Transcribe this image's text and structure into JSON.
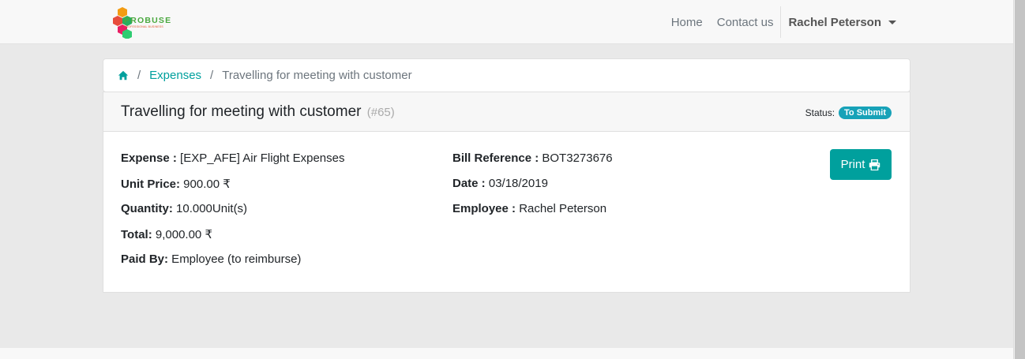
{
  "navbar": {
    "logo_text": "PROBUSE",
    "logo_subtext": "PROFESSIONAL BUSINESS",
    "links": [
      "Home",
      "Contact us"
    ],
    "user_name": "Rachel Peterson"
  },
  "breadcrumb": {
    "home_icon": "home-icon",
    "items": [
      "Expenses",
      "Travelling for meeting with customer"
    ]
  },
  "expense": {
    "title": "Travelling for meeting with customer",
    "ref": "(#65)",
    "status_label": "Status:",
    "status_value": "To Submit",
    "status_color": "#17a2b8",
    "print_label": "Print",
    "fields_left": [
      {
        "label": "Expense :",
        "value": " [EXP_AFE] Air Flight Expenses"
      },
      {
        "label": "Unit Price:",
        "value": " 900.00 ₹"
      },
      {
        "label": "Quantity:",
        "value": " 10.000Unit(s)"
      },
      {
        "label": "Total:",
        "value": " 9,000.00 ₹"
      },
      {
        "label": "Paid By:",
        "value": " Employee (to reimburse)"
      }
    ],
    "fields_right": [
      {
        "label": "Bill Reference :",
        "value": " BOT3273676"
      },
      {
        "label": "Date :",
        "value": " 03/18/2019"
      },
      {
        "label": "Employee :",
        "value": " Rachel Peterson"
      }
    ]
  },
  "colors": {
    "accent": "#00a09d",
    "badge": "#17a2b8"
  }
}
